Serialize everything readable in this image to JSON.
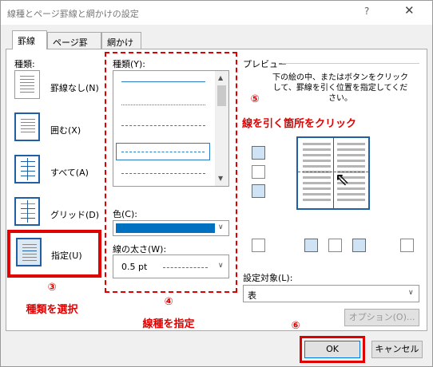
{
  "dialog": {
    "title": "線種とページ罫線と網かけの設定",
    "help": "?",
    "close": "✕"
  },
  "tabs": [
    {
      "label": "罫線"
    },
    {
      "label": "ページ罫線"
    },
    {
      "label": "網かけ"
    }
  ],
  "setting": {
    "label": "種類:",
    "presets": [
      {
        "label": "罫線なし(N)"
      },
      {
        "label": "囲む(X)"
      },
      {
        "label": "すべて(A)"
      },
      {
        "label": "グリッド(D)"
      },
      {
        "label": "指定(U)"
      }
    ]
  },
  "style": {
    "label": "種類(Y):",
    "color_label": "色(C):",
    "width_label": "線の太さ(W):",
    "width_value": "0.5 pt"
  },
  "preview": {
    "label": "プレビュー",
    "instruction": "下の絵の中、またはボタンをクリックして、罫線を引く位置を指定してください。"
  },
  "apply_to": {
    "label": "設定対象(L):",
    "value": "表"
  },
  "buttons": {
    "options": "オプション(O)...",
    "ok": "OK",
    "cancel": "キャンセル"
  },
  "annotations": {
    "step3": "③",
    "step3_text": "種類を選択",
    "step4": "④",
    "step4_text": "線種を指定",
    "step5": "⑤",
    "step5_text": "線を引く箇所をクリック",
    "step6": "⑥"
  },
  "colors": {
    "accent_red": "#e00000",
    "selected_color": "#0070c0",
    "dashed_line": "#2a79c7"
  }
}
